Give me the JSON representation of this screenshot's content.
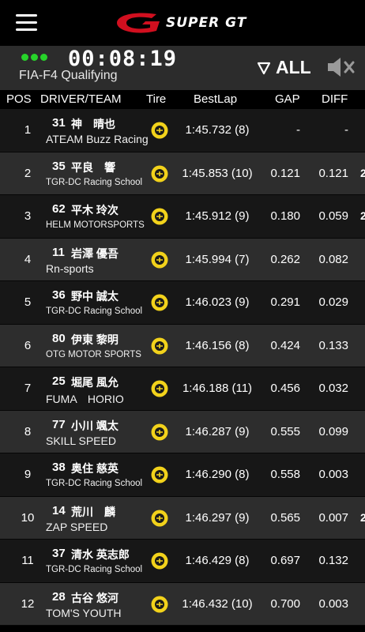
{
  "header": {
    "brand": "SUPER GT",
    "brand_color": "#d10f1f"
  },
  "status": {
    "timer": "00:08:19",
    "session": "FIA-F4 Qualifying",
    "filter_label": "ALL",
    "live_color": "#27d32a"
  },
  "columns": {
    "pos": "POS",
    "driver_team": "DRIVER/TEAM",
    "tire": "Tire",
    "best_lap": "BestLap",
    "gap": "GAP",
    "diff": "DIFF"
  },
  "results": [
    {
      "pos": "1",
      "num": "31",
      "driver": "神　晴也",
      "team": "ATEAM Buzz Racing",
      "team_small": false,
      "best_lap": "1:45.732 (8)",
      "gap": "-",
      "diff": "-",
      "edge": ""
    },
    {
      "pos": "2",
      "num": "35",
      "driver": "平良　響",
      "team": "TGR-DC Racing School",
      "team_small": true,
      "best_lap": "1:45.853 (10)",
      "gap": "0.121",
      "diff": "0.121",
      "edge": "2"
    },
    {
      "pos": "3",
      "num": "62",
      "driver": "平木 玲次",
      "team": "HELM MOTORSPORTS",
      "team_small": true,
      "best_lap": "1:45.912 (9)",
      "gap": "0.180",
      "diff": "0.059",
      "edge": "2"
    },
    {
      "pos": "4",
      "num": "11",
      "driver": "岩澤 優吾",
      "team": "Rn-sports",
      "team_small": false,
      "best_lap": "1:45.994 (7)",
      "gap": "0.262",
      "diff": "0.082",
      "edge": ""
    },
    {
      "pos": "5",
      "num": "36",
      "driver": "野中 誠太",
      "team": "TGR-DC Racing School",
      "team_small": true,
      "best_lap": "1:46.023 (9)",
      "gap": "0.291",
      "diff": "0.029",
      "edge": ""
    },
    {
      "pos": "6",
      "num": "80",
      "driver": "伊東 黎明",
      "team": "OTG MOTOR SPORTS",
      "team_small": true,
      "best_lap": "1:46.156 (8)",
      "gap": "0.424",
      "diff": "0.133",
      "edge": ""
    },
    {
      "pos": "7",
      "num": "25",
      "driver": "堀尾 風允",
      "team": "FUMA　HORIO",
      "team_small": false,
      "best_lap": "1:46.188 (11)",
      "gap": "0.456",
      "diff": "0.032",
      "edge": ""
    },
    {
      "pos": "8",
      "num": "77",
      "driver": "小川 颯太",
      "team": "SKILL SPEED",
      "team_small": false,
      "best_lap": "1:46.287 (9)",
      "gap": "0.555",
      "diff": "0.099",
      "edge": ""
    },
    {
      "pos": "9",
      "num": "38",
      "driver": "奥住 慈英",
      "team": "TGR-DC Racing School",
      "team_small": true,
      "best_lap": "1:46.290 (8)",
      "gap": "0.558",
      "diff": "0.003",
      "edge": ""
    },
    {
      "pos": "10",
      "num": "14",
      "driver": "荒川　麟",
      "team": "ZAP SPEED",
      "team_small": false,
      "best_lap": "1:46.297 (9)",
      "gap": "0.565",
      "diff": "0.007",
      "edge": "2"
    },
    {
      "pos": "11",
      "num": "37",
      "driver": "清水 英志郎",
      "team": "TGR-DC Racing School",
      "team_small": true,
      "best_lap": "1:46.429 (8)",
      "gap": "0.697",
      "diff": "0.132",
      "edge": ""
    },
    {
      "pos": "12",
      "num": "28",
      "driver": "古谷 悠河",
      "team": "TOM'S YOUTH",
      "team_small": false,
      "best_lap": "1:46.432 (10)",
      "gap": "0.700",
      "diff": "0.003",
      "edge": ""
    }
  ]
}
